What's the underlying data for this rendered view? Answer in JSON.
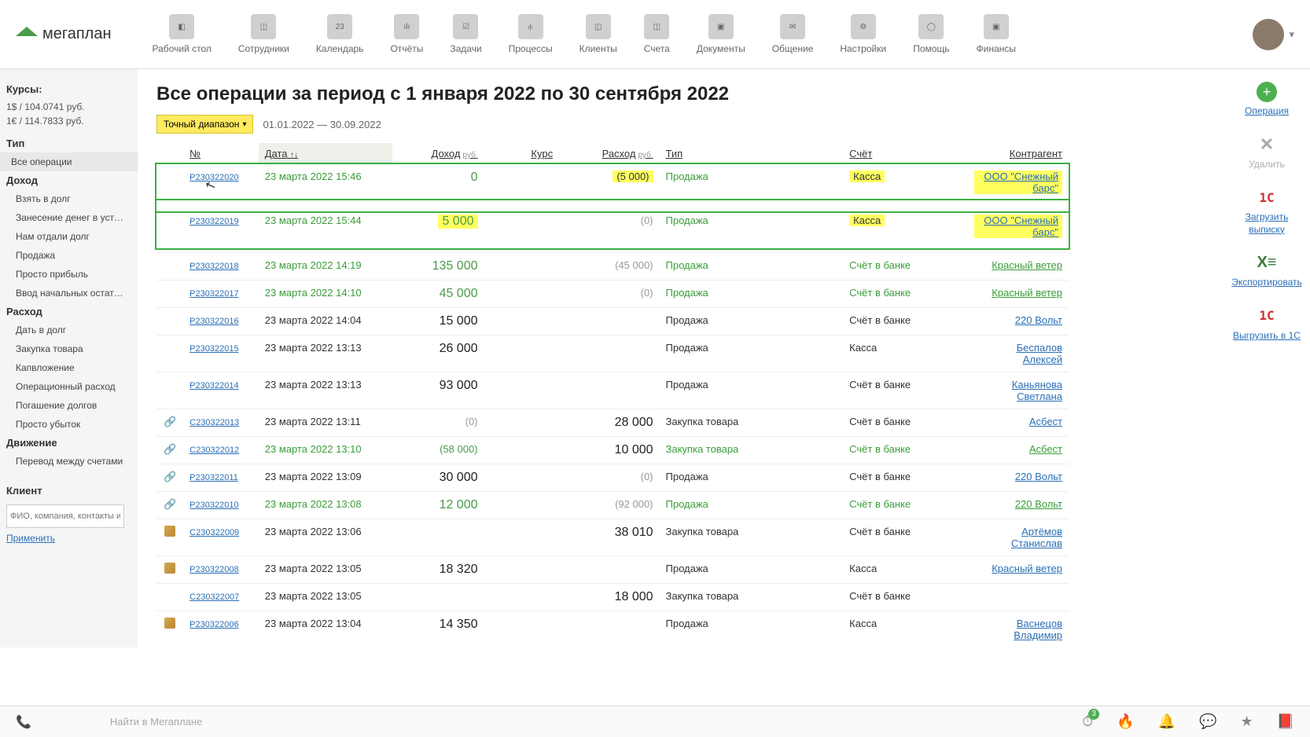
{
  "logo_text": "мегаплан",
  "nav": [
    {
      "label": "Рабочий стол",
      "icon": "◧"
    },
    {
      "label": "Сотрудники",
      "icon": "◫"
    },
    {
      "label": "Календарь",
      "icon": "23"
    },
    {
      "label": "Отчёты",
      "icon": "ılı"
    },
    {
      "label": "Задачи",
      "icon": "☑"
    },
    {
      "label": "Процессы",
      "icon": "⫛"
    },
    {
      "label": "Клиенты",
      "icon": "◫"
    },
    {
      "label": "Счета",
      "icon": "◫"
    },
    {
      "label": "Документы",
      "icon": "▣"
    },
    {
      "label": "Общение",
      "icon": "✉"
    },
    {
      "label": "Настройки",
      "icon": "⚙"
    },
    {
      "label": "Помощь",
      "icon": "◯"
    },
    {
      "label": "Финансы",
      "icon": "▣"
    }
  ],
  "sidebar": {
    "rates_title": "Курсы:",
    "rate_usd": "1$ / 104.0741 руб.",
    "rate_eur": "1€ / 114.7833 руб.",
    "type_title": "Тип",
    "all_ops": "Все операции",
    "income_title": "Доход",
    "income_items": [
      "Взять в долг",
      "Занесение денег в уставной ...",
      "Нам отдали долг",
      "Продажа",
      "Просто прибыль",
      "Ввод начальных остатков"
    ],
    "expense_title": "Расход",
    "expense_items": [
      "Дать в долг",
      "Закупка товара",
      "Капвложение",
      "Операционный расход",
      "Погашение долгов",
      "Просто убыток"
    ],
    "movement_title": "Движение",
    "movement_items": [
      "Перевод между счетами"
    ],
    "client_title": "Клиент",
    "client_placeholder": "ФИО, компания, контакты или стрелка вниз для",
    "apply": "Применить"
  },
  "main": {
    "title": "Все операции за период с 1 января 2022 по 30 сентября 2022",
    "range_btn": "Точный диапазон",
    "range_text": "01.01.2022 — 30.09.2022",
    "headers": {
      "no": "№",
      "date": "Дата",
      "date_sort": "↑↓",
      "income": "Доход",
      "income_sub": "руб.",
      "rate": "Курс",
      "expense": "Расход",
      "expense_sub": "руб.",
      "type": "Тип",
      "account": "Счёт",
      "counterparty": "Контрагент"
    }
  },
  "rows": [
    {
      "id": "P230322020",
      "date": "23 марта 2022 15:46",
      "income": "0",
      "income_cls": "amount-green",
      "rate": "",
      "expense": "(5 000)",
      "expense_hl": true,
      "type": "Продажа",
      "account": "Касса",
      "account_hl": true,
      "counter": "ООО \"Снежный барс\"",
      "counter_hl": true,
      "date_green": true,
      "boxed": true
    },
    {
      "id": "P230322019",
      "date": "23 марта 2022 15:44",
      "income": "5 000",
      "income_hl": true,
      "income_cls": "amount-green",
      "rate": "",
      "expense": "(0)",
      "expense_gray": true,
      "type": "Продажа",
      "account": "Касса",
      "account_hl": true,
      "counter": "ООО \"Снежный барс\"",
      "counter_hl": true,
      "date_green": true,
      "boxed": true
    },
    {
      "id": "P230322018",
      "date": "23 марта 2022 14:19",
      "income": "135 000",
      "income_cls": "amount-green",
      "expense": "(45 000)",
      "expense_gray": true,
      "type": "Продажа",
      "account": "Счёт в банке",
      "account_green": true,
      "counter": "Красный ветер",
      "counter_green": true,
      "date_green": true
    },
    {
      "id": "P230322017",
      "date": "23 марта 2022 14:10",
      "income": "45 000",
      "income_cls": "amount-green",
      "expense": "(0)",
      "expense_gray": true,
      "type": "Продажа",
      "account": "Счёт в банке",
      "account_green": true,
      "counter": "Красный ветер",
      "counter_green": true,
      "date_green": true
    },
    {
      "id": "P230322016",
      "date": "23 марта 2022 14:04",
      "income": "15 000",
      "income_cls": "amount-black",
      "type": "Продажа",
      "account": "Счёт в банке",
      "counter": "220 Вольт"
    },
    {
      "id": "P230322015",
      "date": "23 марта 2022 13:13",
      "income": "26 000",
      "income_cls": "amount-black",
      "type": "Продажа",
      "account": "Касса",
      "counter": "Беспалов Алексей"
    },
    {
      "id": "P230322014",
      "date": "23 марта 2022 13:13",
      "income": "93 000",
      "income_cls": "amount-black",
      "type": "Продажа",
      "account": "Счёт в банке",
      "counter": "Каньянова Светлана"
    },
    {
      "id": "C230322013",
      "date": "23 марта 2022 13:11",
      "income": "(0)",
      "income_gray": true,
      "expense": "28 000",
      "expense_black": true,
      "type": "Закупка товара",
      "account": "Счёт в банке",
      "counter": "Асбест",
      "chain": true
    },
    {
      "id": "C230322012",
      "date": "23 марта 2022 13:10",
      "income": "(58 000)",
      "income_gray": true,
      "income_greenparen": true,
      "expense": "10 000",
      "expense_black": true,
      "type": "Закупка товара",
      "account": "Счёт в банке",
      "account_green": true,
      "counter": "Асбест",
      "counter_green": true,
      "date_green": true,
      "chain": true
    },
    {
      "id": "P230322011",
      "date": "23 марта 2022 13:09",
      "income": "30 000",
      "income_cls": "amount-black",
      "expense": "(0)",
      "expense_gray": true,
      "type": "Продажа",
      "account": "Счёт в банке",
      "counter": "220 Вольт",
      "chain": true
    },
    {
      "id": "P230322010",
      "date": "23 марта 2022 13:08",
      "income": "12 000",
      "income_cls": "amount-green",
      "expense": "(92 000)",
      "expense_gray": true,
      "type": "Продажа",
      "account": "Счёт в банке",
      "account_green": true,
      "counter": "220 Вольт",
      "counter_green": true,
      "date_green": true,
      "chain": true
    },
    {
      "id": "C230322009",
      "date": "23 марта 2022 13:06",
      "expense": "38 010",
      "expense_black": true,
      "type": "Закупка товара",
      "account": "Счёт в банке",
      "counter": "Артёмов Станислав",
      "doc": true
    },
    {
      "id": "P230322008",
      "date": "23 марта 2022 13:05",
      "income": "18 320",
      "income_cls": "amount-black",
      "type": "Продажа",
      "account": "Касса",
      "counter": "Красный ветер",
      "doc": true
    },
    {
      "id": "C230322007",
      "date": "23 марта 2022 13:05",
      "expense": "18 000",
      "expense_black": true,
      "type": "Закупка товара",
      "account": "Счёт в банке",
      "counter": ""
    },
    {
      "id": "P230322006",
      "date": "23 марта 2022 13:04",
      "income": "14 350",
      "income_cls": "amount-black",
      "type": "Продажа",
      "account": "Касса",
      "counter": "Васнецов Владимир",
      "doc": true
    }
  ],
  "rightbar": {
    "op": "Операция",
    "del": "Удалить",
    "load": "Загрузить выписку",
    "export": "Экспортировать",
    "upload": "Выгрузить в 1С"
  },
  "footer": {
    "search_placeholder": "Найти в Мегаплане"
  }
}
